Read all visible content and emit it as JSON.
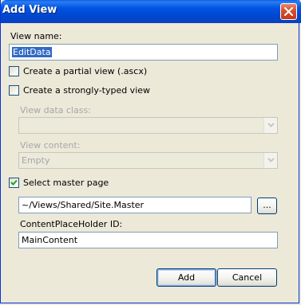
{
  "window": {
    "title": "Add View"
  },
  "form": {
    "view_name_label": "View name:",
    "view_name_value": "EditData",
    "partial_view_label": "Create a partial view (.ascx)",
    "partial_view_checked": false,
    "strongly_typed_label": "Create a strongly-typed view",
    "strongly_typed_checked": false,
    "view_data_class_label": "View data class:",
    "view_data_class_value": "",
    "view_content_label": "View content:",
    "view_content_value": "Empty",
    "master_page_label": "Select master page",
    "master_page_checked": true,
    "master_page_path": "~/Views/Shared/Site.Master",
    "browse_label": "...",
    "placeholder_id_label": "ContentPlaceHolder ID:",
    "placeholder_id_value": "MainContent"
  },
  "buttons": {
    "add": "Add",
    "cancel": "Cancel"
  },
  "icons": {
    "close": "close-icon",
    "dropdown": "chevron-down-icon",
    "check": "checkmark-icon"
  },
  "colors": {
    "titlebar": "#0054E3",
    "dialog_bg": "#ECE9D8",
    "selection": "#316AC5",
    "close_button": "#D7502C"
  }
}
